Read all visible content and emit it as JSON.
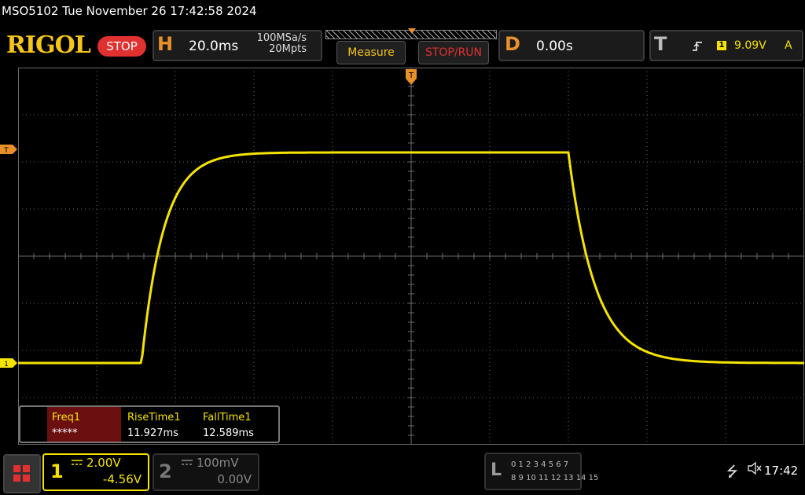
{
  "header": {
    "title": "MSO5102  Tue November 26 17:42:58 2024"
  },
  "toolbar": {
    "logo": "RIGOL",
    "run_state": "STOP",
    "horizontal": {
      "letter": "H",
      "timebase": "20.0ms",
      "sample_rate": "100MSa/s",
      "memory_depth": "20Mpts"
    },
    "measure_label": "Measure",
    "stoprun_label": "STOP/RUN",
    "delay": {
      "letter": "D",
      "value": "0.00s"
    },
    "trigger": {
      "letter": "T",
      "slope_icon": "rising-edge-icon",
      "source": "1",
      "level": "9.09V",
      "mode": "A"
    }
  },
  "screen": {
    "trigger_position_label": "T",
    "trigger_level_label": "T",
    "ch1_ground_label": "1"
  },
  "measurements": [
    {
      "name": "Freq1",
      "value": "*****"
    },
    {
      "name": "RiseTime1",
      "value": "11.927ms"
    },
    {
      "name": "FallTime1",
      "value": "12.589ms"
    }
  ],
  "channels": {
    "ch1": {
      "number": "1",
      "coupling_icon": "dc-coupling-icon",
      "scale": "2.00V",
      "offset": "-4.56V",
      "color": "#f5e400"
    },
    "ch2": {
      "number": "2",
      "coupling_icon": "dc-coupling-icon",
      "scale": "100mV",
      "offset": "0.00V",
      "color": "#888888"
    }
  },
  "logic": {
    "letter": "L",
    "row1": "0 1 2 3  4 5 6 7",
    "row2": "8 9 10 11 12 13 14 15"
  },
  "status": {
    "usb_icon": "usb-icon",
    "sound_icon": "speaker-muted-icon",
    "time": "17:42"
  },
  "colors": {
    "trace": "#f5e400",
    "accent": "#e8902a",
    "stop": "#e03030",
    "grid": "#6a6a6a"
  }
}
